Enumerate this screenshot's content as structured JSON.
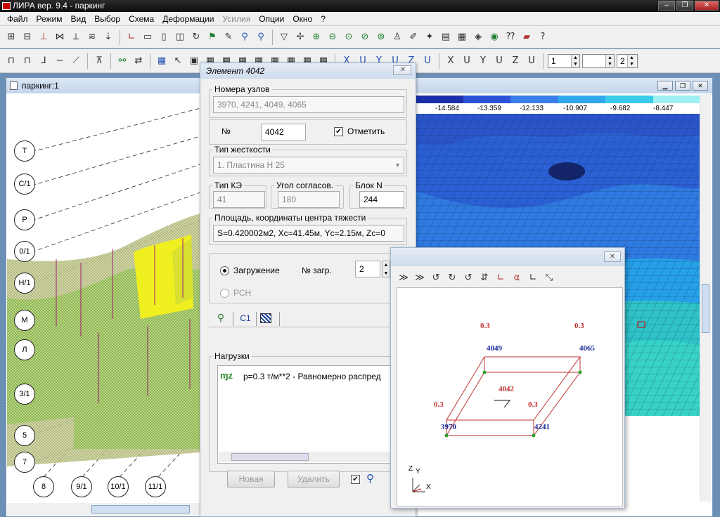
{
  "app": {
    "title": "ЛИРА  вер. 9.4 - паркинг"
  },
  "menu": [
    "Файл",
    "Режим",
    "Вид",
    "Выбор",
    "Схема",
    "Деформации",
    "Усилия",
    "Опции",
    "Окно",
    "?"
  ],
  "toolbar2": {
    "spin1": "1",
    "spin2": "",
    "spin3": "2"
  },
  "child": {
    "title": "паркинг:1"
  },
  "model": {
    "axis_labels_vertical": [
      "T",
      "С/1",
      "Р",
      "0/1",
      "Н/1",
      "М",
      "Л",
      "3/1",
      "5",
      "7"
    ],
    "axis_labels_horizontal": [
      "8",
      "9/1",
      "10/1",
      "11/1"
    ]
  },
  "scale": {
    "values": [
      "-14.584",
      "-13.359",
      "-12.133",
      "-10.907",
      "-9.682",
      "-8.447"
    ]
  },
  "element_dialog": {
    "title": "Элемент 4042",
    "nodes_group": "Номера узлов",
    "nodes_value": "3970, 4241, 4049, 4065",
    "no_label": "№",
    "no_value": "4042",
    "mark_label": "Отметить",
    "mark_checked": "✔",
    "stiffness_group": "Тип жесткости",
    "stiffness_value": "1. Пластина  Н 25",
    "fe_type_group": "Тип КЭ",
    "fe_type_value": "41",
    "angle_group": "Угол согласов.",
    "angle_value": "180",
    "block_group": "Блок N",
    "block_value": "244",
    "area_group": "Площадь, координаты центра тяжести",
    "area_value": "S=0.420002м2, Xc=41.45м, Yc=2.15м, Zc=0",
    "loading_label": "Загружение",
    "load_no_label": "№ загр.",
    "load_no_value": "2",
    "rsn_label": "РСН",
    "tab_c1": "С1",
    "loads_group": "Нагрузки",
    "load_item_icon": "ɱz",
    "load_item": "p=0.3 т/м**2 - Равномерно распред",
    "new_button": "Новая",
    "delete_button": "Удалить"
  },
  "element_view": {
    "node_labels": {
      "n4049": "4049",
      "n4065": "4065",
      "n3970": "3970",
      "n4241": "4241",
      "element": "4042"
    },
    "load_labels": [
      "0.3",
      "0.3",
      "0.3",
      "0.3"
    ],
    "axis_labels": {
      "z": "Z",
      "y": "Y",
      "x": "X"
    }
  }
}
